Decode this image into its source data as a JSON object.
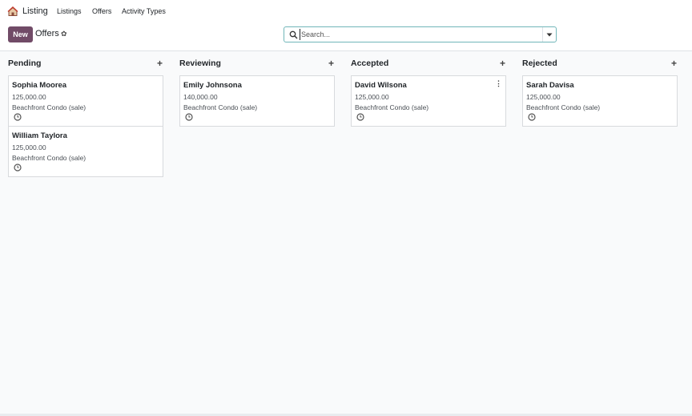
{
  "navbar": {
    "app_name": "Listing",
    "menu": [
      "Listings",
      "Offers",
      "Activity Types"
    ]
  },
  "control_panel": {
    "new_label": "New",
    "title": "Offers",
    "search_placeholder": "Search..."
  },
  "kanban": {
    "columns": [
      {
        "title": "Pending",
        "cards": [
          {
            "name": "Sophia Moorea",
            "price": "125,000.00",
            "property": "Beachfront Condo (sale)"
          },
          {
            "name": "William Taylora",
            "price": "125,000.00",
            "property": "Beachfront Condo (sale)"
          }
        ]
      },
      {
        "title": "Reviewing",
        "cards": [
          {
            "name": "Emily Johnsona",
            "price": "140,000.00",
            "property": "Beachfront Condo (sale)"
          }
        ]
      },
      {
        "title": "Accepted",
        "cards": [
          {
            "name": "David Wilsona",
            "price": "125,000.00",
            "property": "Beachfront Condo (sale)"
          }
        ]
      },
      {
        "title": "Rejected",
        "cards": [
          {
            "name": "Sarah Davisa",
            "price": "125,000.00",
            "property": "Beachfront Condo (sale)"
          }
        ]
      }
    ]
  },
  "colors": {
    "primary": "#714b67",
    "search_border": "#71b6b9",
    "background": "#f9fafb"
  },
  "icons": {
    "app": "house-icon",
    "settings": "gear-icon",
    "search": "search-icon",
    "toggle": "caret-down-icon",
    "add": "plus-icon",
    "activity": "clock-icon",
    "card_menu": "kebab-menu-icon"
  }
}
